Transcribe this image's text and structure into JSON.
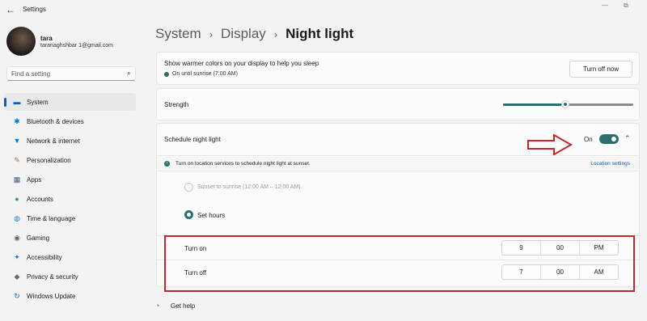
{
  "window": {
    "title": "Settings",
    "back_icon": "←",
    "minimize_icon": "—",
    "restore_icon": "⧉"
  },
  "user": {
    "name": "tara",
    "email": "taranaghshbar        1@gmail.com"
  },
  "search": {
    "placeholder": "Find a setting",
    "icon": "search-icon"
  },
  "sidebar": {
    "items": [
      {
        "label": "System",
        "icon": "system-icon",
        "glyph": "▬",
        "color": "#0067c0",
        "active": true
      },
      {
        "label": "Bluetooth & devices",
        "icon": "bluetooth-icon",
        "glyph": "✱",
        "color": "#0078d4"
      },
      {
        "label": "Network & internet",
        "icon": "wifi-icon",
        "glyph": "▼",
        "color": "#0078d4"
      },
      {
        "label": "Personalization",
        "icon": "brush-icon",
        "glyph": "✎",
        "color": "#b06a2a"
      },
      {
        "label": "Apps",
        "icon": "apps-icon",
        "glyph": "▦",
        "color": "#3d5a80"
      },
      {
        "label": "Accounts",
        "icon": "accounts-icon",
        "glyph": "●",
        "color": "#2f9e6e"
      },
      {
        "label": "Time & language",
        "icon": "globe-icon",
        "glyph": "◍",
        "color": "#1f7fbf"
      },
      {
        "label": "Gaming",
        "icon": "gaming-icon",
        "glyph": "◉",
        "color": "#666666"
      },
      {
        "label": "Accessibility",
        "icon": "accessibility-icon",
        "glyph": "✦",
        "color": "#1a73c8"
      },
      {
        "label": "Privacy & security",
        "icon": "shield-icon",
        "glyph": "◆",
        "color": "#6b6b6b"
      },
      {
        "label": "Windows Update",
        "icon": "update-icon",
        "glyph": "↻",
        "color": "#0078d4"
      }
    ]
  },
  "breadcrumb": {
    "items": [
      "System",
      "Display"
    ],
    "current": "Night light",
    "separator": "›"
  },
  "night_light": {
    "description": "Show warmer colors on your display to help you sleep",
    "status": "On until sunrise (7:00 AM)",
    "turn_off_button": "Turn off now"
  },
  "strength": {
    "label": "Strength",
    "value_fraction": 0.48
  },
  "schedule": {
    "label": "Schedule night light",
    "toggle_label": "On",
    "toggle_on": true,
    "chevron": "⌃",
    "info_text": "Turn on location services to schedule night light at sunset.",
    "location_link": "Location settings",
    "option_sunset": "Sunset to sunrise (12:00 AM – 12:00 AM)",
    "option_set_hours": "Set hours",
    "selected_option": "Set hours",
    "turn_on": {
      "label": "Turn on",
      "hour": "9",
      "minute": "00",
      "period": "PM"
    },
    "turn_off": {
      "label": "Turn off",
      "hour": "7",
      "minute": "00",
      "period": "AM"
    }
  },
  "help": {
    "label": "Get help"
  },
  "colors": {
    "accent": "#2a6f6f",
    "annotation": "#c0272d",
    "nav_indicator": "#005fb8"
  }
}
